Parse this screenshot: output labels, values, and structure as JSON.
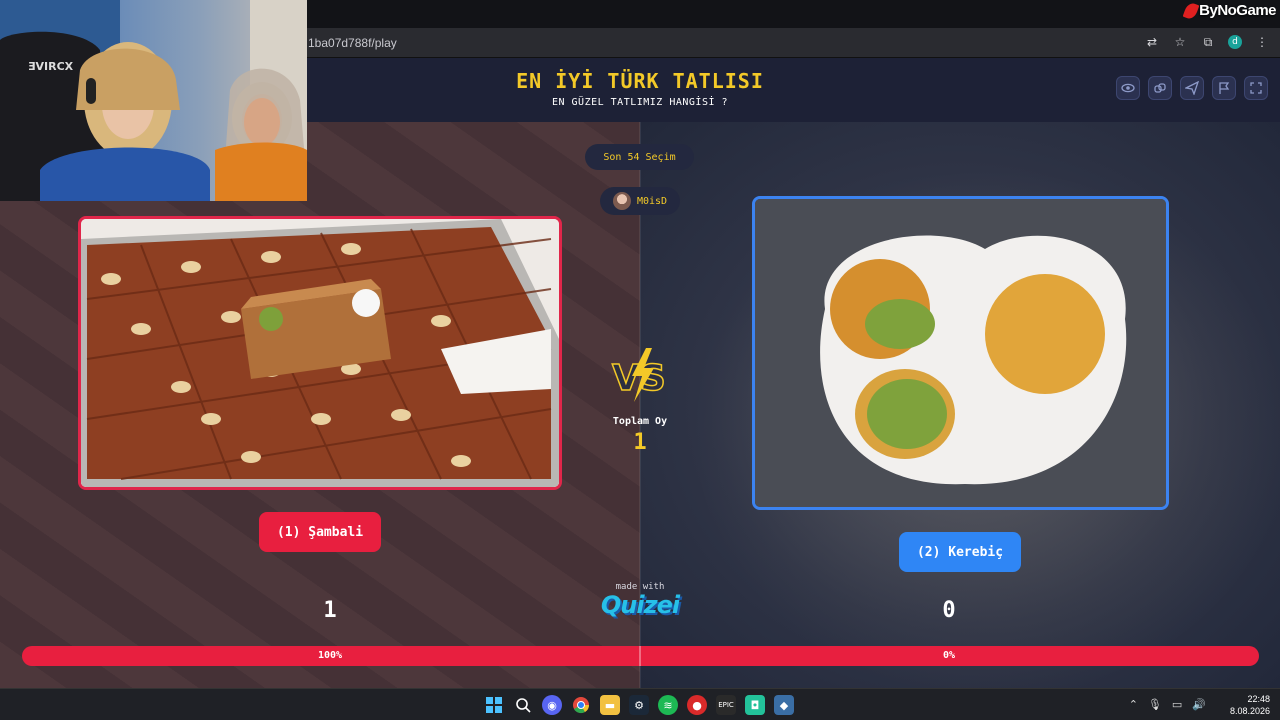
{
  "watermark": "ByNoGame",
  "browser": {
    "url": "1ba07d788f/play"
  },
  "header": {
    "title": "EN İYİ TÜRK TATLISI",
    "subtitle": "EN GÜZEL TATLIMIZ HANGİSİ ?"
  },
  "status": {
    "recent_choices": "Son 54 Seçim",
    "username": "M0isD"
  },
  "vote": {
    "total_label": "Toplam Oy",
    "total_value": "1"
  },
  "options": [
    {
      "label": "(1) Şambali",
      "score": "1",
      "percent": "100%",
      "color": "#e81f3f"
    },
    {
      "label": "(2) Kerebiç",
      "score": "0",
      "percent": "0%",
      "color": "#2f86f5"
    }
  ],
  "branding": {
    "made_with": "made with",
    "logo": "Quizei"
  },
  "taskbar": {
    "time": "22:48",
    "date": "8.08.2026"
  },
  "icons": [
    "translate-icon",
    "star-icon",
    "extensions-icon",
    "profile-icon",
    "more-icon",
    "eye-icon",
    "link-icon",
    "send-icon",
    "flag-icon",
    "fullscreen-icon"
  ]
}
